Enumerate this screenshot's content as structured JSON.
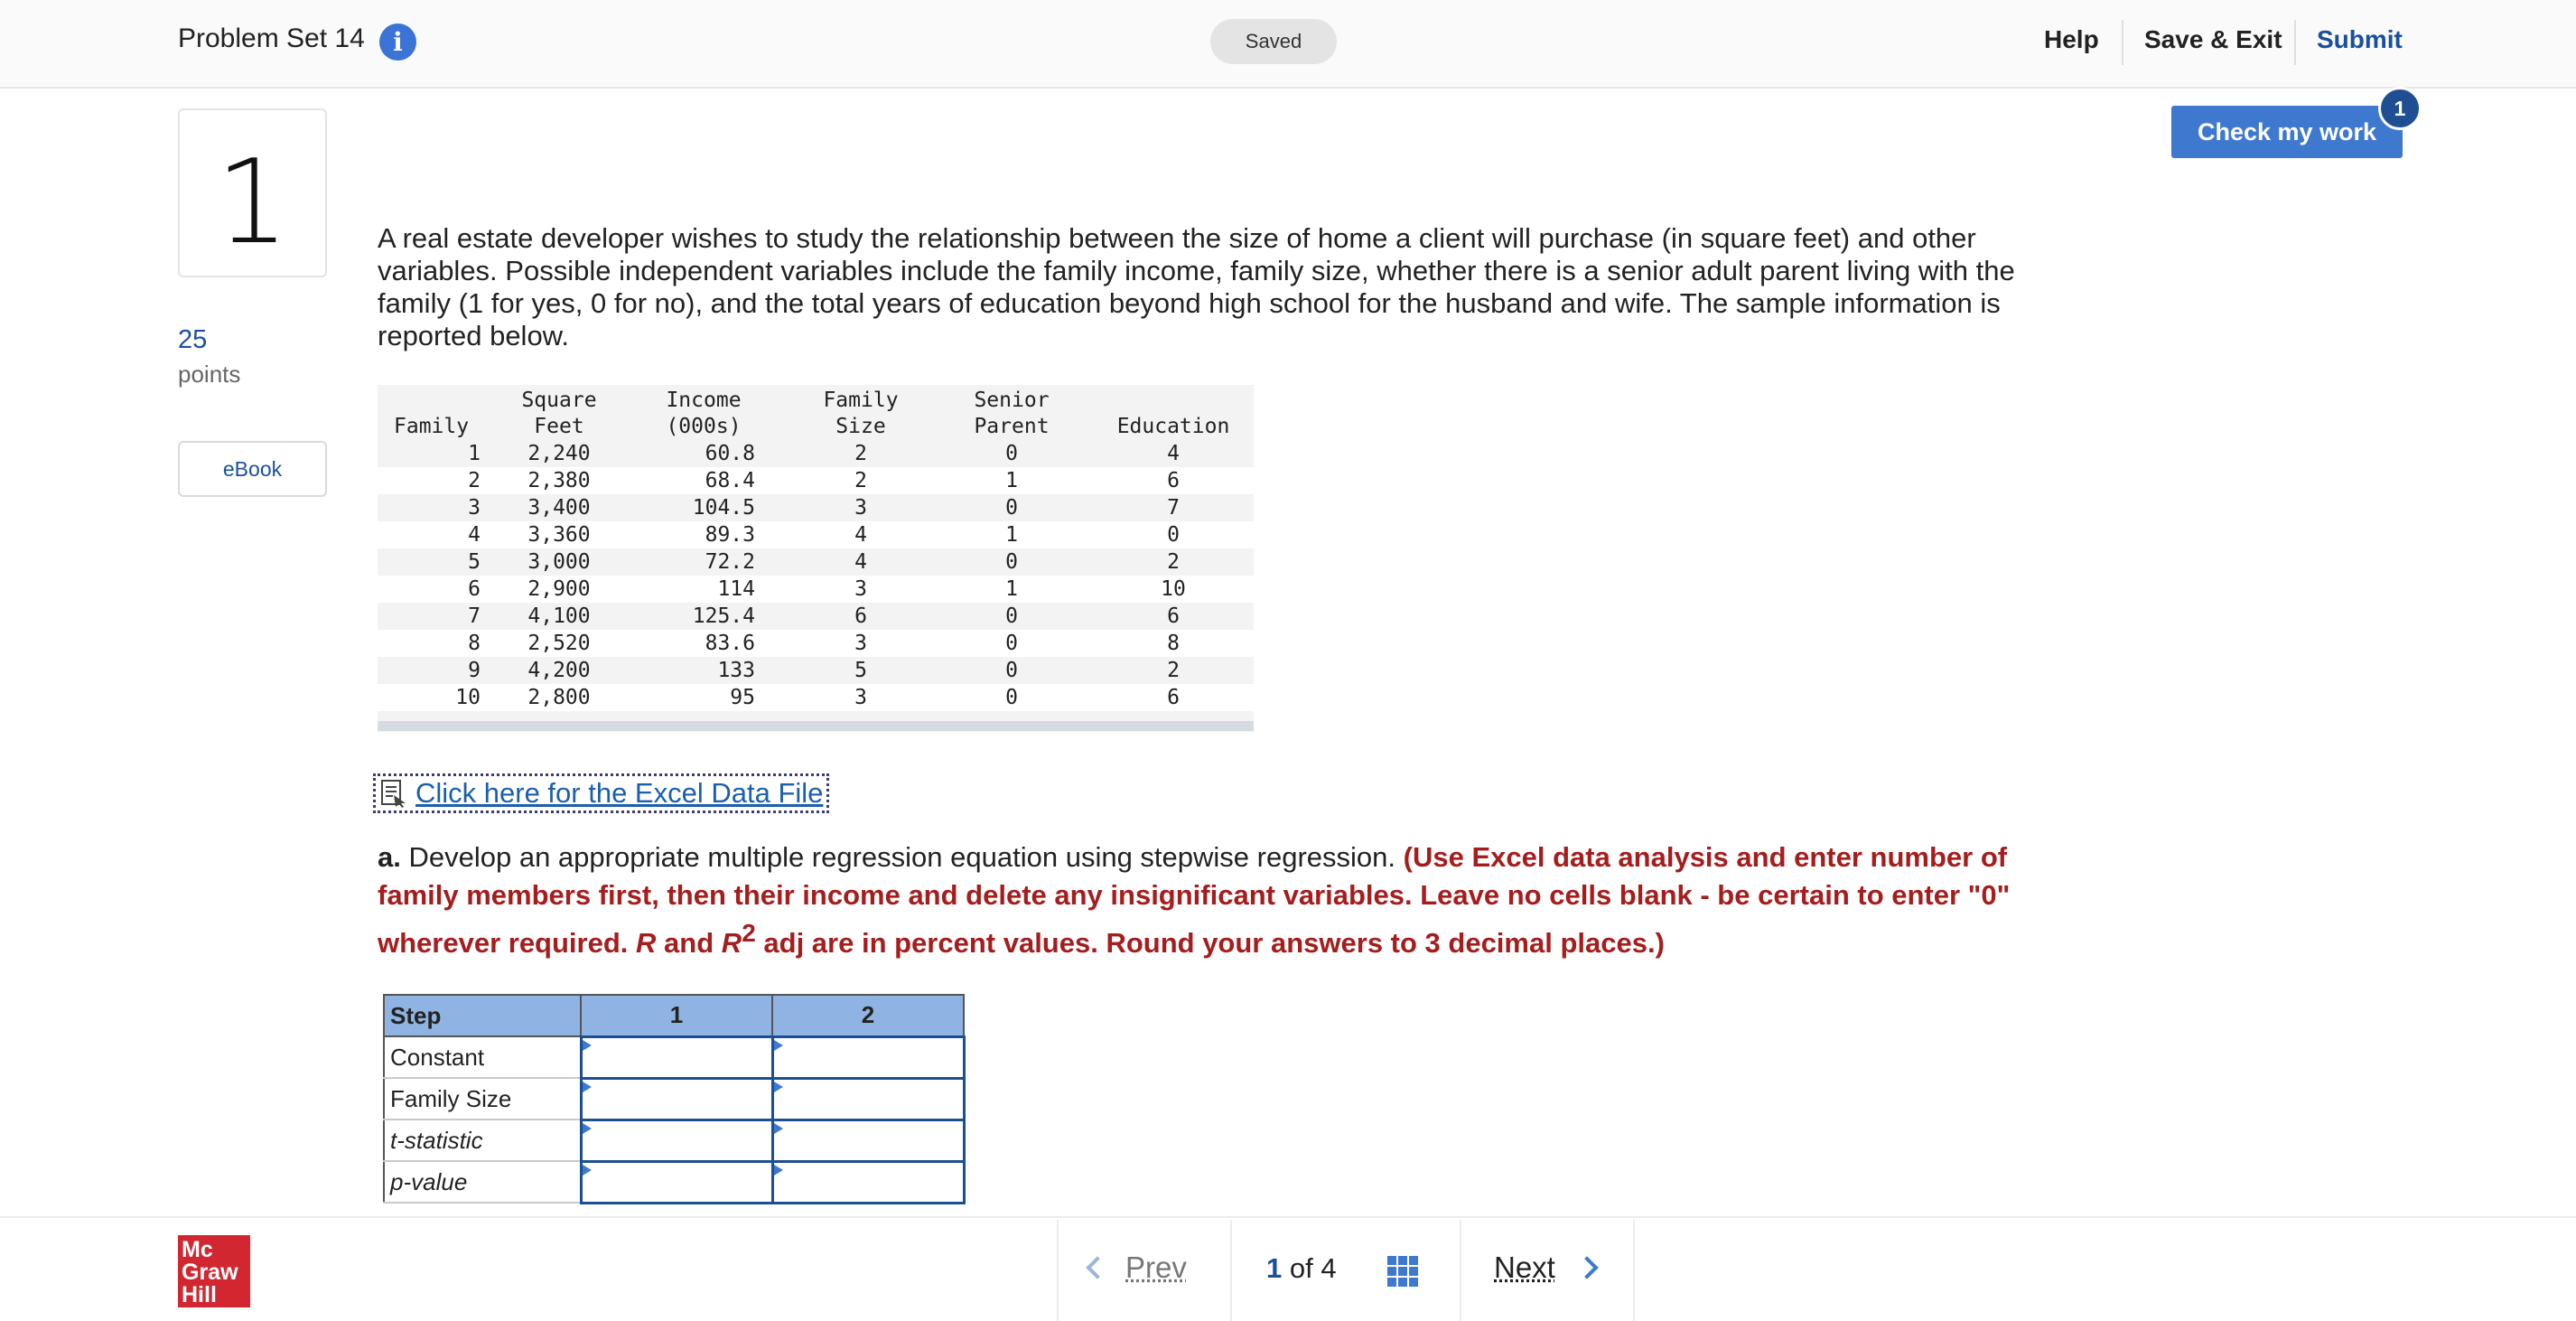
{
  "header": {
    "title": "Problem Set 14",
    "info_icon": "info-icon",
    "status": "Saved",
    "help": "Help",
    "save_exit": "Save & Exit",
    "submit": "Submit",
    "accent": "#3e79cf"
  },
  "question": {
    "number": "1",
    "points_value": "25",
    "points_label": "points",
    "ebook": "eBook",
    "check_label": "Check my work",
    "check_badge": "1",
    "text": "A real estate developer wishes to study the relationship between the size of home a client will purchase (in square feet) and other variables. Possible independent variables include the family income, family size, whether there is a senior adult parent living with the family (1 for yes, 0 for no), and the total years of education beyond high school for the husband and wife. The sample information is reported below."
  },
  "data_table": {
    "headers": [
      [
        "",
        "Family"
      ],
      [
        "Square",
        "Feet"
      ],
      [
        "Income",
        "(000s)"
      ],
      [
        "Family",
        "Size"
      ],
      [
        "Senior",
        "Parent"
      ],
      [
        "",
        "Education"
      ]
    ],
    "rows": [
      [
        "1",
        "2,240",
        "60.8",
        "2",
        "0",
        "4"
      ],
      [
        "2",
        "2,380",
        "68.4",
        "2",
        "1",
        "6"
      ],
      [
        "3",
        "3,400",
        "104.5",
        "3",
        "0",
        "7"
      ],
      [
        "4",
        "3,360",
        "89.3",
        "4",
        "1",
        "0"
      ],
      [
        "5",
        "3,000",
        "72.2",
        "4",
        "0",
        "2"
      ],
      [
        "6",
        "2,900",
        "114",
        "3",
        "1",
        "10"
      ],
      [
        "7",
        "4,100",
        "125.4",
        "6",
        "0",
        "6"
      ],
      [
        "8",
        "2,520",
        "83.6",
        "3",
        "0",
        "8"
      ],
      [
        "9",
        "4,200",
        "133",
        "5",
        "0",
        "2"
      ],
      [
        "10",
        "2,800",
        "95",
        "3",
        "0",
        "6"
      ]
    ]
  },
  "excel_link": {
    "icon": "spreadsheet-file-icon",
    "label": "Click here for the Excel Data File"
  },
  "part_a": {
    "label": "a.",
    "text": "Develop an appropriate multiple regression equation using stepwise regression.",
    "instr_1": "(Use Excel data analysis and enter number of family members first, then their income and delete any insignificant variables. Leave no cells blank - be certain to enter \"0\" wherever required.",
    "r_symbol": "R",
    "and_word": "and",
    "r2_symbol": "R",
    "r2_sup": "2",
    "instr_2": "adj are in percent values. Round your answers to 3 decimal places.)"
  },
  "answer_table": {
    "headers": [
      "Step",
      "1",
      "2"
    ],
    "rows": [
      "Constant",
      "Family Size",
      "t-statistic",
      "p-value"
    ]
  },
  "footer": {
    "logo_lines": [
      "Mc",
      "Graw",
      "Hill"
    ],
    "prev": "Prev",
    "current_page": "1",
    "of_word": "of",
    "total_pages": "4",
    "next": "Next"
  }
}
